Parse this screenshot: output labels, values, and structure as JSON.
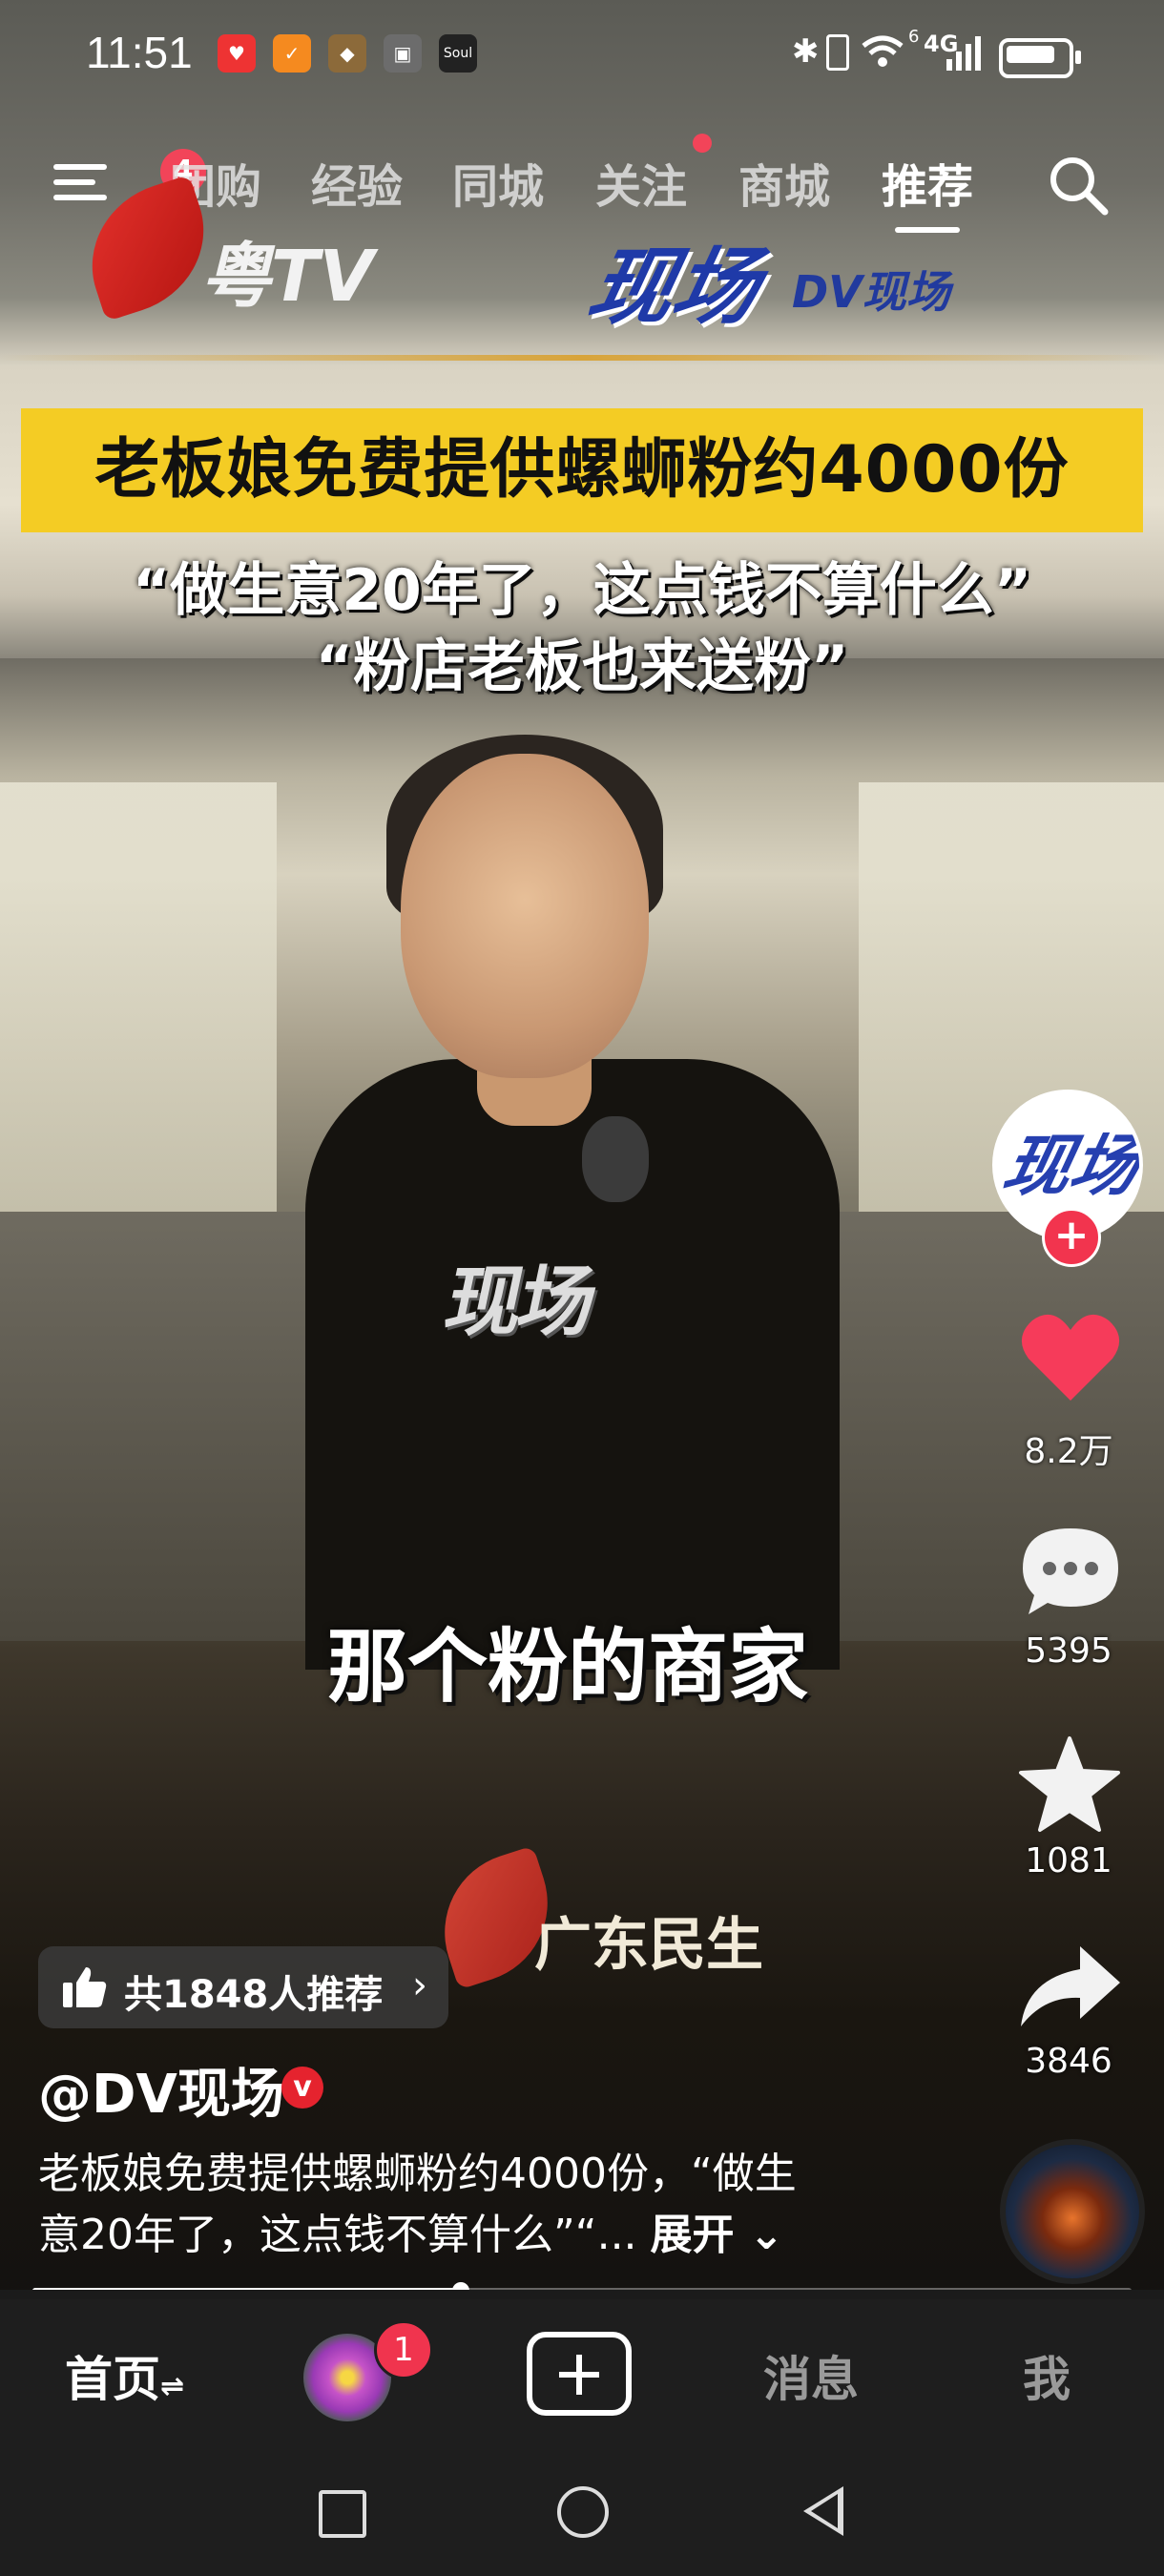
{
  "status_bar": {
    "time": "11:51",
    "signal_text": "4G",
    "sim_label": "6"
  },
  "top_nav": {
    "menu_badge": "4",
    "tabs": [
      "团购",
      "经验",
      "同城",
      "关注",
      "商城",
      "推荐"
    ],
    "active_tab": "推荐"
  },
  "video": {
    "channel_logo_text": "粤TV",
    "program_logo_text": "现场",
    "program_logo_suffix": "DV现场",
    "headline": "老板娘免费提供螺蛳粉约4000份",
    "sub_quote_1": "“做生意20年了，这点钱不算什么”",
    "sub_quote_2": "“粉店老板也来送粉”",
    "shirt_text": "现场",
    "caption": "那个粉的商家",
    "bottom_logo_text": "广东民生"
  },
  "recommend": {
    "label": "共1848人推荐",
    "chevron": "›"
  },
  "author": {
    "handle": "@DV现场",
    "verified_badge": "v"
  },
  "description": {
    "line1": "老板娘免费提供螺蛳粉约4000份，“做生",
    "line2": "意20年了，这点钱不算什么”“...",
    "expand_label": "展开"
  },
  "actions": {
    "avatar_text": "现场",
    "follow_plus": "+",
    "likes": "8.2万",
    "comments": "5395",
    "favorites": "1081",
    "shares": "3846"
  },
  "playback": {
    "progress": 0.39
  },
  "bottom_nav": {
    "home_label": "首页",
    "home_suffix": "⇌",
    "friends_badge": "1",
    "messages_label": "消息",
    "me_label": "我"
  },
  "colors": {
    "accent_red": "#f24459",
    "headline_yellow": "#f4cc24",
    "dv_blue": "#1f3aa8"
  },
  "icons": {
    "menu": "menu-icon",
    "search": "search-icon",
    "like": "heart-icon",
    "comment": "comment-icon",
    "favorite": "star-icon",
    "share": "share-icon",
    "thumb": "thumb-up-icon",
    "add": "plus-icon"
  }
}
